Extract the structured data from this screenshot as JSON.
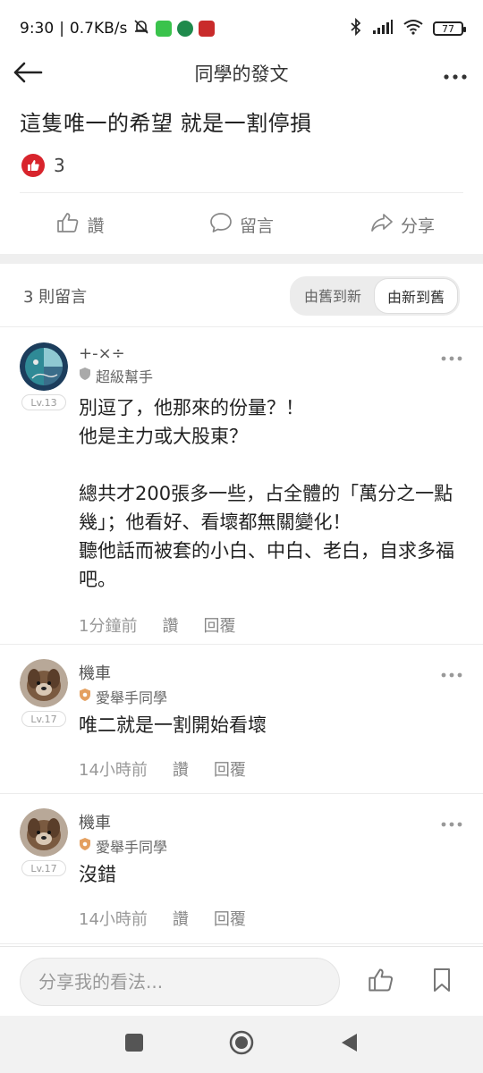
{
  "status_bar": {
    "time": "9:30",
    "net_speed": "0.7KB/s",
    "battery": "77",
    "icons": [
      "silent-bell-icon",
      "line-app-icon",
      "bank-app-icon",
      "red-app-icon",
      "bluetooth-icon",
      "signal-icon",
      "wifi-icon",
      "battery-icon"
    ]
  },
  "header": {
    "title": "同學的發文"
  },
  "post": {
    "title": "這隻唯一的希望 就是一割停損",
    "like_count": "3"
  },
  "actions": {
    "like": "讚",
    "comment": "留言",
    "share": "分享"
  },
  "comments_section": {
    "count_label": "3 則留言",
    "sort_old_new": "由舊到新",
    "sort_new_old": "由新到舊"
  },
  "comments": [
    {
      "name": "+-×÷",
      "role": "超級幫手",
      "level": "Lv.13",
      "text": "別逗了，他那來的份量？！\n他是主力或大股東？\n\n總共才200張多一些，占全體的「萬分之一點幾」；他看好、看壞都無關變化！\n聽他話而被套的小白、中白、老白，自求多福吧。",
      "time": "1分鐘前",
      "like": "讚",
      "reply": "回覆"
    },
    {
      "name": "機車",
      "role": "愛舉手同學",
      "level": "Lv.17",
      "text": "唯二就是一割開始看壞",
      "time": "14小時前",
      "like": "讚",
      "reply": "回覆"
    },
    {
      "name": "機車",
      "role": "愛舉手同學",
      "level": "Lv.17",
      "text": "沒錯",
      "time": "14小時前",
      "like": "讚",
      "reply": "回覆"
    }
  ],
  "input": {
    "placeholder": "分享我的看法..."
  },
  "colors": {
    "accent_red": "#d8242c",
    "text_dark": "#222222",
    "text_gray": "#999999"
  }
}
